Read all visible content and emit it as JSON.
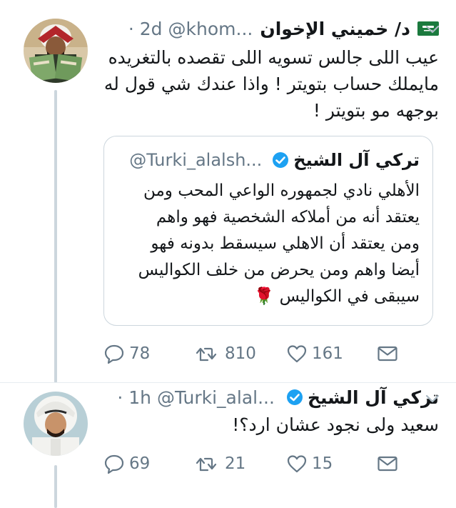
{
  "tweet1": {
    "author_name": "د/ خميني الإخوان",
    "handle": "@khom...",
    "time": "· 2d",
    "text_lines": [
      "عيب اللى جالس تسويه اللى تقصده بالتغريده",
      "مايملك حساب بتويتر ! واذا عندك شي قول له",
      "بوجهه مو بتويتر !"
    ],
    "quote": {
      "author_name": "تركي آل الشيخ",
      "handle": "@Turki_alalsh...",
      "text_lines": [
        "الأهلي نادي لجمهوره الواعي المحب ومن",
        "يعتقد أنه من أملاكه الشخصية فهو واهم",
        "ومن يعتقد أن الاهلي سيسقط بدونه فهو",
        "أيضا واهم ومن يحرض من خلف الكواليس",
        "سيبقى في الكواليس 🌹"
      ]
    },
    "actions": {
      "replies": "78",
      "retweets": "810",
      "likes": "161"
    }
  },
  "tweet2": {
    "author_name": "تركي آل الشيخ",
    "handle": "@Turki_alal...",
    "time": "· 1h",
    "text": "سعيد ولى نجود عشان ارد؟!",
    "actions": {
      "replies": "69",
      "retweets": "21",
      "likes": "15"
    }
  },
  "colors": {
    "text": "#14171a",
    "secondary": "#657786",
    "verified": "#1da1f2",
    "border": "#ccd6dd",
    "like": "#e0245e"
  }
}
